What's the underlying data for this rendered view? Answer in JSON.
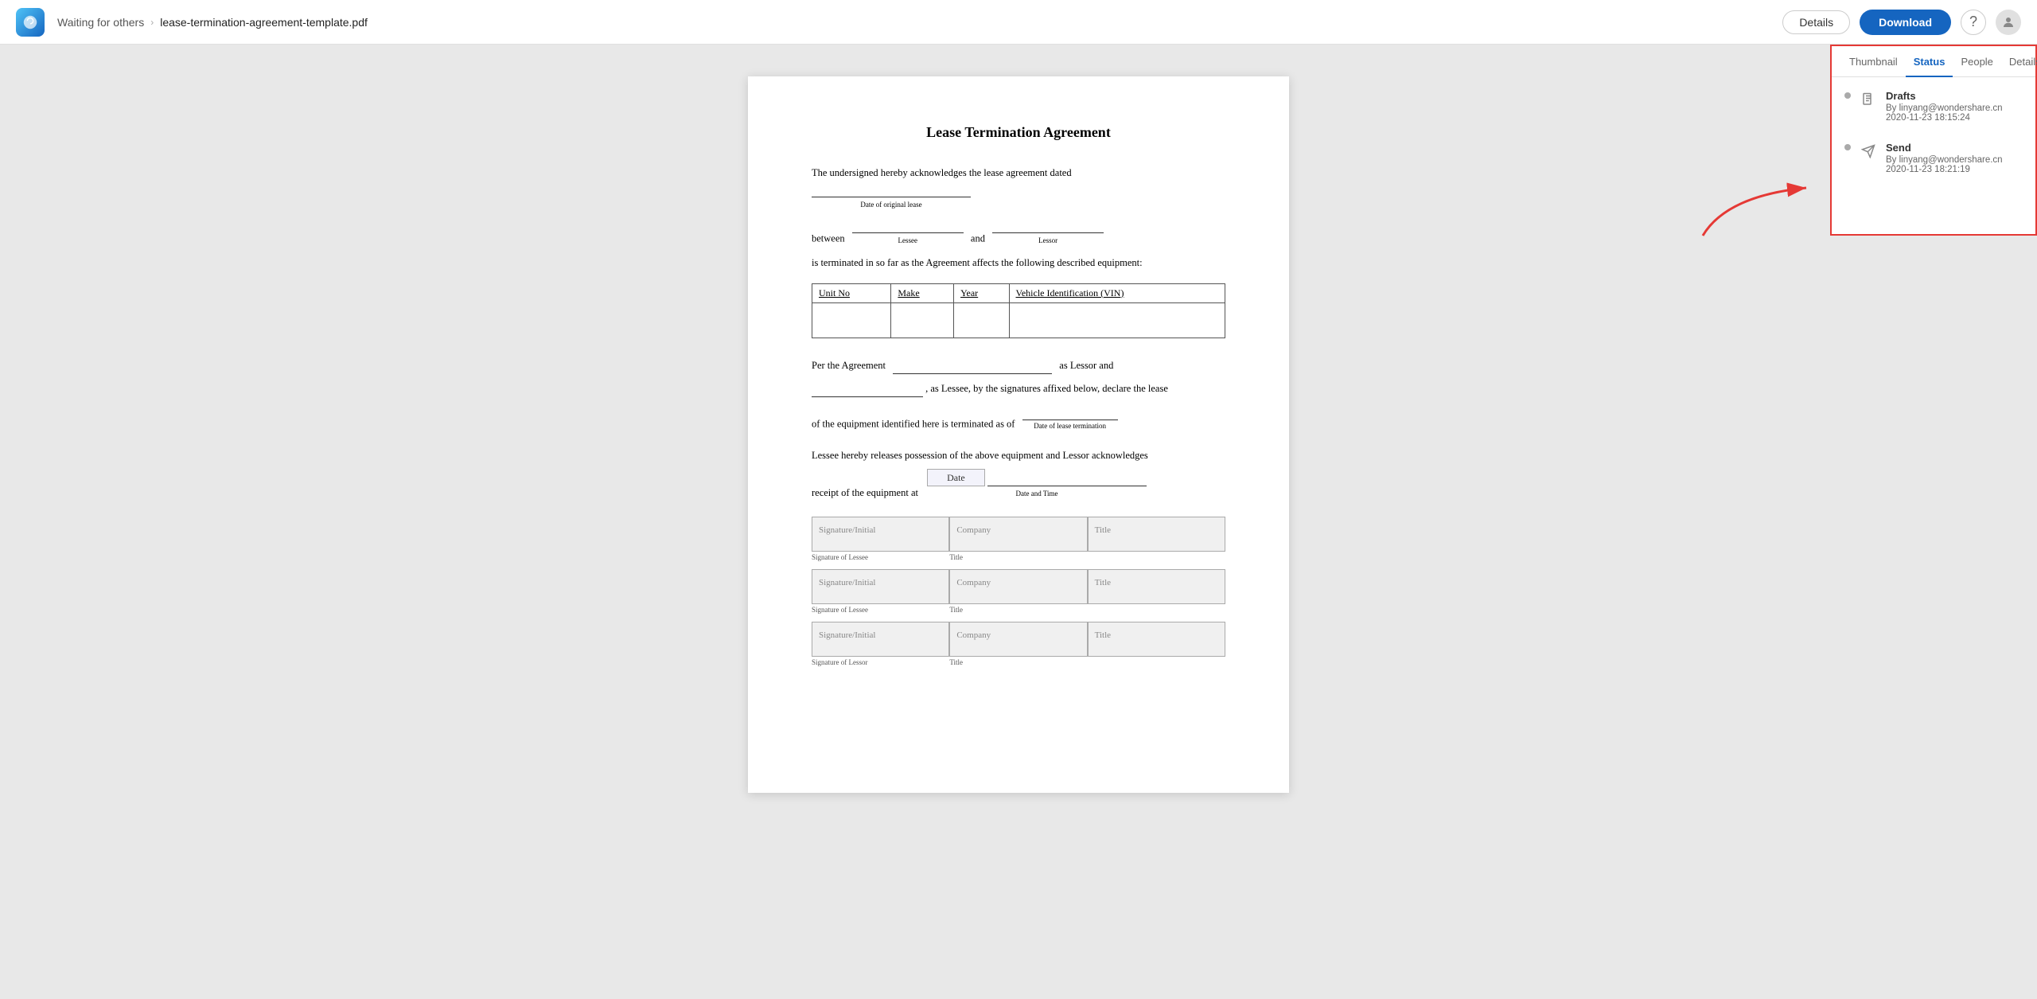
{
  "topbar": {
    "breadcrumb_waiting": "Waiting for others",
    "breadcrumb_chevron": "›",
    "filename": "lease-termination-agreement-template.pdf",
    "btn_details": "Details",
    "btn_download": "Download"
  },
  "panel": {
    "tabs": [
      "Thumbnail",
      "Status",
      "People",
      "Details"
    ],
    "active_tab": "Status",
    "items": [
      {
        "type": "Drafts",
        "icon": "document-icon",
        "by": "By linyang@wondershare.cn",
        "time": "2020-11-23 18:15:24"
      },
      {
        "type": "Send",
        "icon": "send-icon",
        "by": "By linyang@wondershare.cn",
        "time": "2020-11-23 18:21:19"
      }
    ]
  },
  "document": {
    "title": "Lease Termination Agreement",
    "para1_prefix": "The undersigned hereby acknowledges the lease agreement dated",
    "para1_label": "Date of original lease",
    "para1_between": "between",
    "para1_and": "and",
    "para1_lessee_label": "Lessee",
    "para1_lessor_label": "Lessor",
    "para2": "is terminated in so far as the Agreement affects the following described equipment:",
    "table_headers": [
      "Unit No",
      "Make",
      "Year",
      "Vehicle Identification (VIN)"
    ],
    "para3_prefix": "Per the Agreement",
    "para3_suffix": "as Lessor and",
    "para4": ", as Lessee, by the signatures affixed below, declare the lease",
    "para5_prefix": "of the equipment identified here is terminated as of",
    "para5_label": "Date of lease termination",
    "para6": "Lessee hereby releases possession of the above equipment and Lessor acknowledges",
    "para7_prefix": "receipt of the equipment at",
    "date_label": "Date",
    "datetime_label": "Date and Time",
    "sig_rows": [
      {
        "sig_label": "Signature of Lessee",
        "company_placeholder": "Company",
        "title_placeholder": "Title"
      },
      {
        "sig_label": "Signature of Lessee",
        "company_placeholder": "Company",
        "title_placeholder": "Title"
      },
      {
        "sig_label": "Signature of Lessor",
        "company_placeholder": "Company",
        "title_placeholder": "Title"
      }
    ],
    "sig_initial_label": "Signature/Initial"
  }
}
